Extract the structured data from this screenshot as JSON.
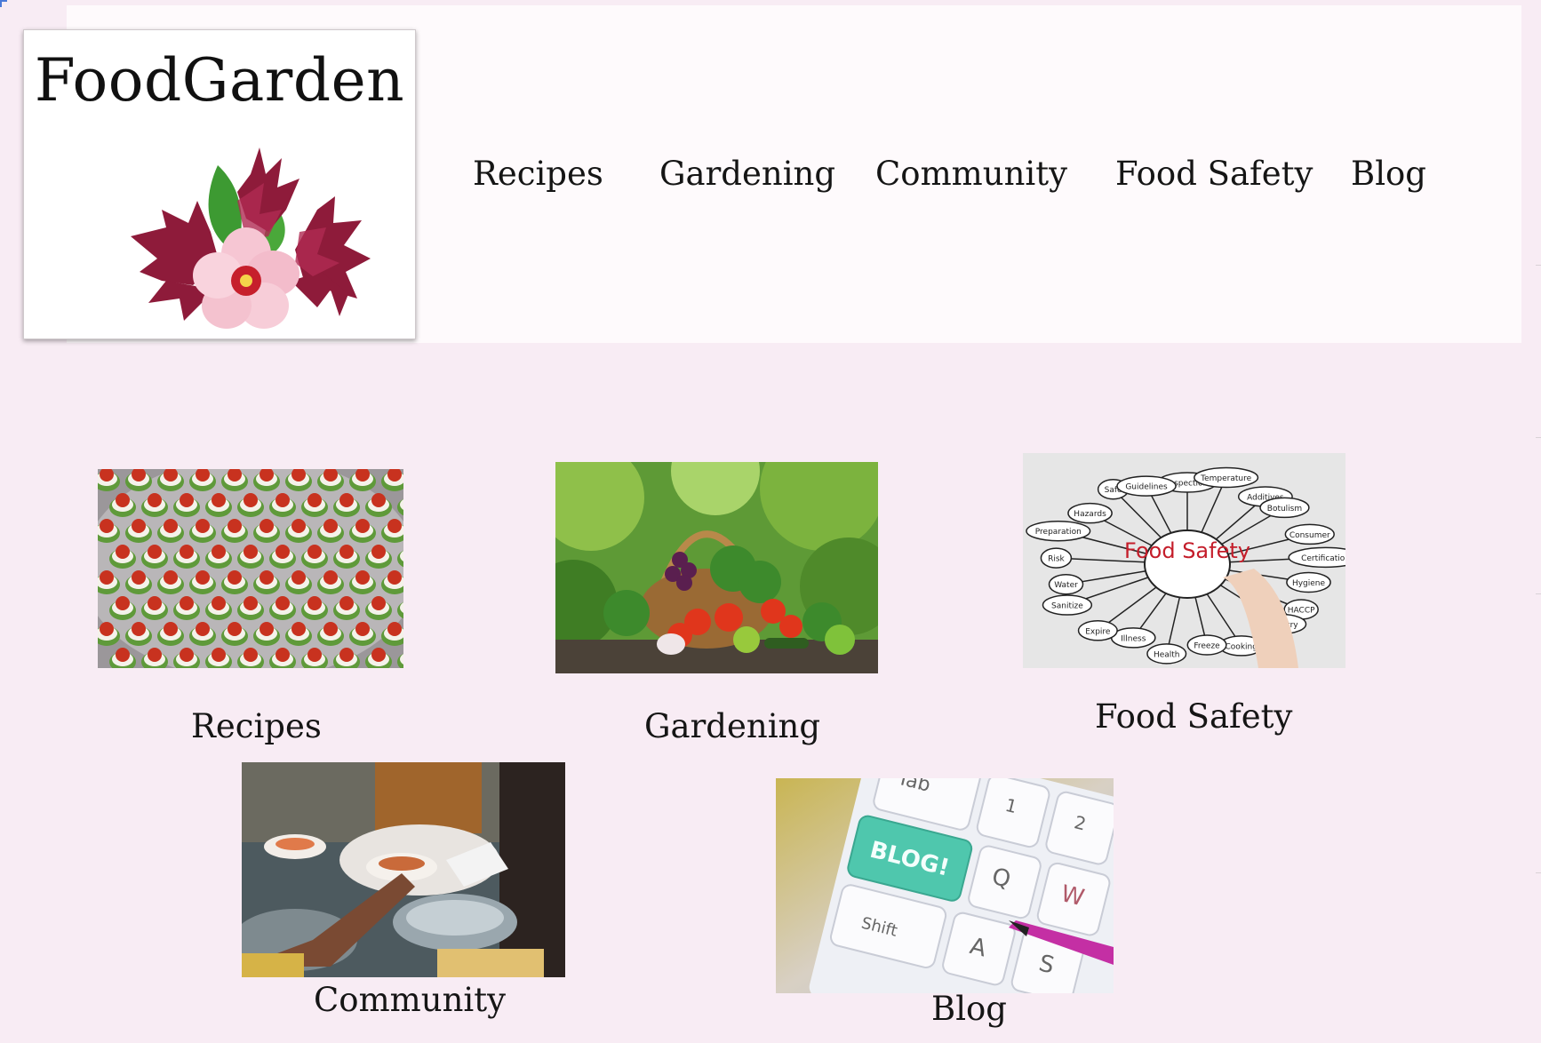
{
  "site": {
    "title": "FoodGarden",
    "logo_icon": "hibiscus-flower-logo"
  },
  "nav": {
    "items": [
      {
        "label": "Recipes"
      },
      {
        "label": "Gardening"
      },
      {
        "label": "Community"
      },
      {
        "label": "Food Safety"
      },
      {
        "label": "Blog"
      }
    ]
  },
  "cards": {
    "recipes": {
      "label": "Recipes",
      "image": "tomato-cucumber-appetizers-photo"
    },
    "gardening": {
      "label": "Gardening",
      "image": "vegetable-basket-photo"
    },
    "food_safety": {
      "label": "Food Safety",
      "image": "food-safety-mindmap-photo",
      "image_text": {
        "center": "Food Safety",
        "terms": [
          "Inspection",
          "Temperature",
          "Additives",
          "Botulism",
          "Consumer",
          "Certification",
          "Hygiene",
          "HACCP",
          "Industry",
          "Cooking",
          "Freeze",
          "Health",
          "Illness",
          "Expire",
          "Sanitize",
          "Water",
          "Risk",
          "Preparation",
          "Hazards",
          "Safe",
          "Guidelines"
        ]
      }
    },
    "community": {
      "label": "Community",
      "image": "community-meal-serving-photo"
    },
    "blog": {
      "label": "Blog",
      "image": "keyboard-blog-key-photo",
      "image_text": {
        "key": "BLOG!",
        "tab": "Tab",
        "shift": "Shift",
        "q": "Q",
        "w": "W",
        "a": "A",
        "s": "S",
        "k1": "1",
        "k2": "2"
      }
    }
  },
  "colors": {
    "page_bg": "#f8ecf4",
    "header_bg": "#fefafc",
    "text": "#151515",
    "blog_key": "#4fc7ad"
  }
}
